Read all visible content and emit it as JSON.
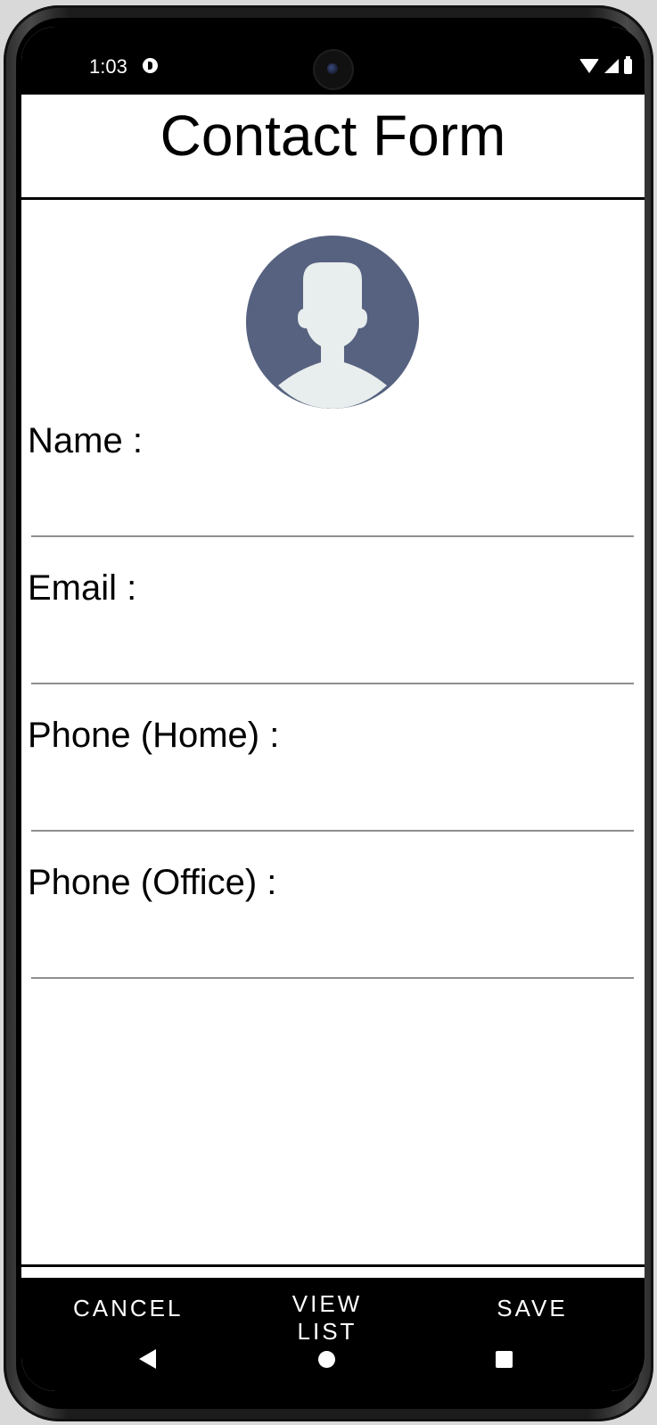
{
  "status_bar": {
    "time": "1:03"
  },
  "header": {
    "title": "Contact Form"
  },
  "avatar": {
    "background_color": "#56627f",
    "silhouette_color": "#e8eded"
  },
  "form": {
    "fields": [
      {
        "label": "Name :",
        "value": "",
        "placeholder": ""
      },
      {
        "label": "Email :",
        "value": "",
        "placeholder": ""
      },
      {
        "label": "Phone (Home) :",
        "value": "",
        "placeholder": ""
      },
      {
        "label": "Phone (Office) :",
        "value": "",
        "placeholder": ""
      }
    ]
  },
  "actions": {
    "cancel_label": "CANCEL",
    "view_list_label": "VIEW LIST",
    "save_label": "SAVE"
  }
}
